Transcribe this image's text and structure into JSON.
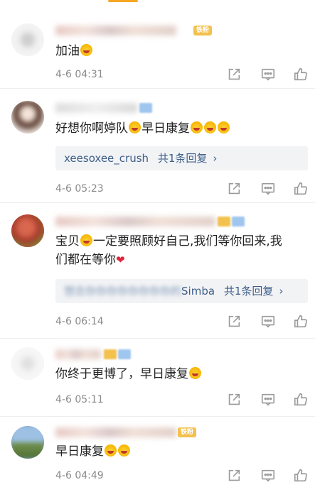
{
  "comments": [
    {
      "badge": "铁粉",
      "text": "加油",
      "time": "4-6 04:31"
    },
    {
      "text": "好想你啊婷队",
      "text_after": "早日康复",
      "reply": {
        "user": "xeesoxee_crush",
        "count": "共1条回复"
      },
      "time": "4-6 05:23"
    },
    {
      "text_line1_a": "宝贝",
      "text_line1_b": "一定要照顾好自己,我们等你回来,我",
      "text_line2": "们都在等你",
      "reply": {
        "user_visible": "Simba",
        "count": "共1条回复"
      },
      "time": "4-6 06:14"
    },
    {
      "text": "你终于更博了，早日康复",
      "time": "4-6 05:11"
    },
    {
      "badge": "铁粉",
      "text": "早日康复",
      "time": "4-6 04:49"
    }
  ],
  "icons": {
    "share": "share-icon",
    "comment": "comment-icon",
    "like": "like-icon"
  },
  "colors": {
    "link": "#3d5f8a",
    "meta": "#8a8a8a",
    "badge": "#f2c14e",
    "heart": "#e0243b"
  }
}
